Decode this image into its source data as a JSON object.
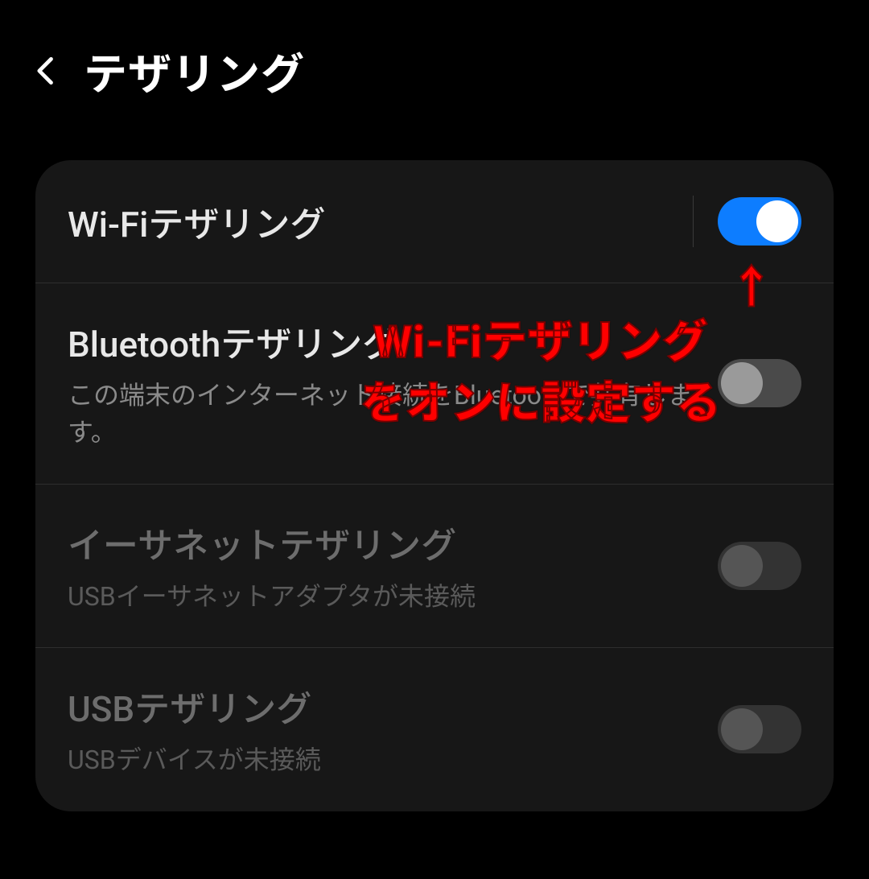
{
  "header": {
    "title": "テザリング"
  },
  "items": {
    "wifi": {
      "title": "Wi-Fiテザリング"
    },
    "bluetooth": {
      "title": "Bluetoothテザリング",
      "desc": "この端末のインターネット接続をBluetoothで共有します。"
    },
    "ethernet": {
      "title": "イーサネットテザリング",
      "desc": "USBイーサネットアダプタが未接続"
    },
    "usb": {
      "title": "USBテザリング",
      "desc": "USBデバイスが未接続"
    }
  },
  "annotation": {
    "arrow": "↑",
    "line1": "Wi-Fiテザリング",
    "line2": "をオンに設定する"
  }
}
